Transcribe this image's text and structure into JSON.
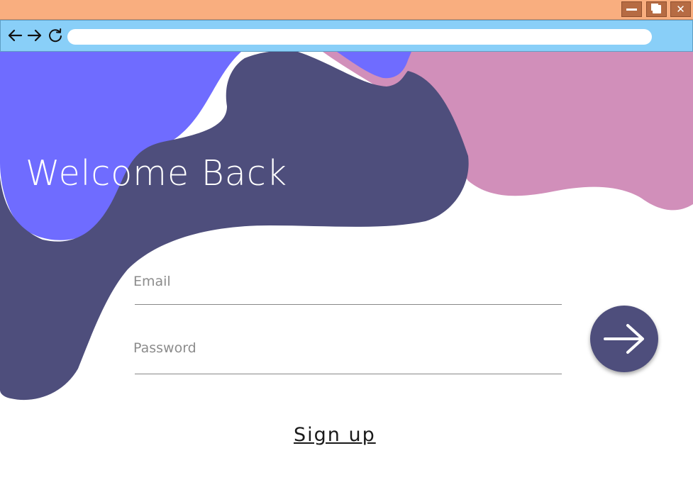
{
  "window": {
    "minimize_icon": "minimize-icon",
    "maximize_icon": "maximize-icon",
    "close_icon": "close-icon",
    "close_glyph": "✕"
  },
  "browser": {
    "back_icon": "arrow-left-icon",
    "forward_icon": "arrow-right-icon",
    "reload_icon": "reload-icon",
    "url": ""
  },
  "colors": {
    "titlebar": "#f9ae7f",
    "addressbar": "#89cff8",
    "blob_periwinkle": "#6f6cff",
    "blob_indigo": "#4e4e7c",
    "blob_pink": "#d18fba",
    "button": "#4e4e7c"
  },
  "hero": {
    "title": "Welcome Back"
  },
  "form": {
    "email_label": "Email",
    "password_label": "Password",
    "email_value": "",
    "password_value": "",
    "submit_icon": "arrow-right-icon",
    "signup_link": "Sign up"
  }
}
